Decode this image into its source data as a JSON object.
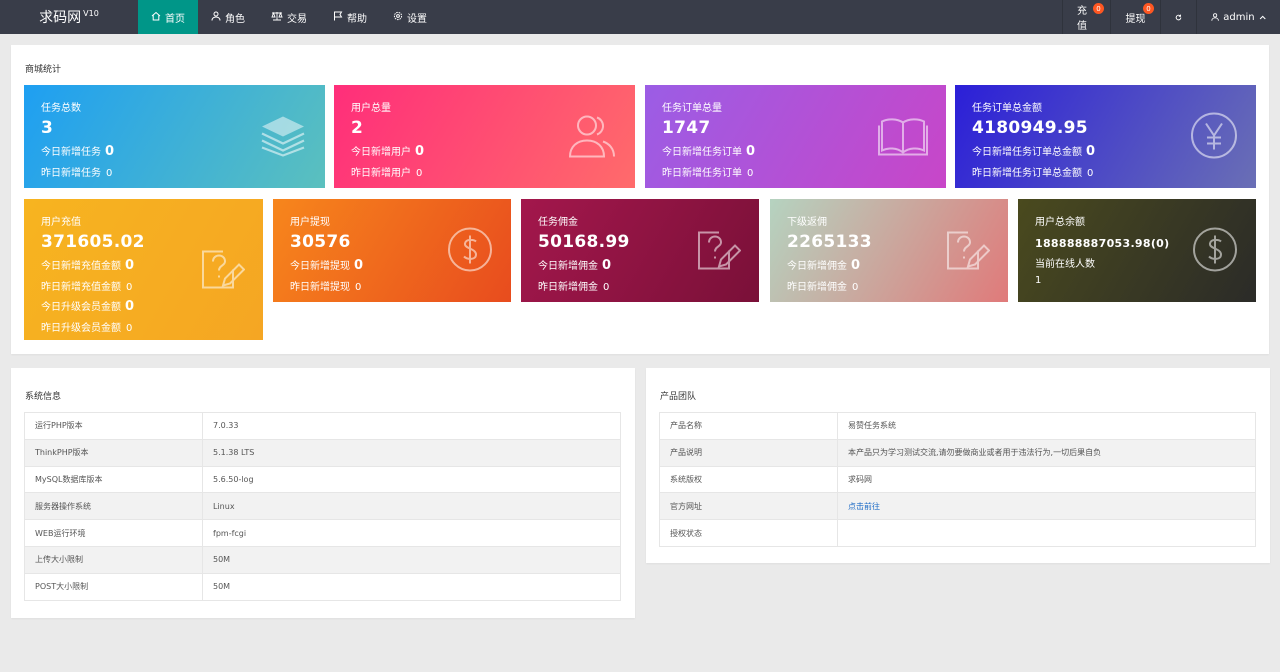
{
  "brand": {
    "name": "求码网",
    "version": "V10"
  },
  "nav": [
    {
      "label": "首页",
      "icon": "home-icon"
    },
    {
      "label": "角色",
      "icon": "user-icon"
    },
    {
      "label": "交易",
      "icon": "scale-icon"
    },
    {
      "label": "帮助",
      "icon": "flag-icon"
    },
    {
      "label": "设置",
      "icon": "gear-icon"
    }
  ],
  "right_nav": {
    "recharge": {
      "label": "充值",
      "badge": "0"
    },
    "withdraw": {
      "label": "提现",
      "badge": "0"
    },
    "refresh_icon": "refresh-icon",
    "user": "admin"
  },
  "stats": {
    "title": "商城统计",
    "cards": [
      {
        "title": "任务总数",
        "value": "3",
        "lines": [
          {
            "label": "今日新增任务",
            "val": "0",
            "bold": true
          },
          {
            "label": "昨日新增任务",
            "val": "0",
            "bold": false
          }
        ],
        "icon": "layers-icon",
        "gradient": [
          "#1e9ff2",
          "#5bc0be"
        ]
      },
      {
        "title": "用户总量",
        "value": "2",
        "lines": [
          {
            "label": "今日新增用户",
            "val": "0",
            "bold": true
          },
          {
            "label": "昨日新增用户",
            "val": "0",
            "bold": false
          }
        ],
        "icon": "users-icon",
        "gradient": [
          "#ff2e7a",
          "#ff6b6b"
        ]
      },
      {
        "title": "任务订单总量",
        "value": "1747",
        "lines": [
          {
            "label": "今日新增任务订单",
            "val": "0",
            "bold": true
          },
          {
            "label": "昨日新增任务订单",
            "val": "0",
            "bold": false
          }
        ],
        "icon": "book-icon",
        "gradient": [
          "#9b5de5",
          "#c846c8"
        ]
      },
      {
        "title": "任务订单总金额",
        "value": "4180949.95",
        "lines": [
          {
            "label": "今日新增任务订单总金额",
            "val": "0",
            "bold": true
          },
          {
            "label": "昨日新增任务订单总金额",
            "val": "0",
            "bold": false
          }
        ],
        "icon": "yen-icon",
        "gradient": [
          "#2b1fd8",
          "#6a6fb5"
        ]
      },
      {
        "title": "用户充值",
        "value": "371605.02",
        "lines": [
          {
            "label": "今日新增充值金额",
            "val": "0",
            "bold": true
          },
          {
            "label": "昨日新增充值金额",
            "val": "0",
            "bold": false
          },
          {
            "label": "今日升级会员金额",
            "val": "0",
            "bold": true
          },
          {
            "label": "昨日升级会员金额",
            "val": "0",
            "bold": false
          }
        ],
        "icon": "edit-icon",
        "gradient": [
          "#f7b420",
          "#f5a623"
        ]
      },
      {
        "title": "用户提现",
        "value": "30576",
        "lines": [
          {
            "label": "今日新增提现",
            "val": "0",
            "bold": true
          },
          {
            "label": "昨日新增提现",
            "val": "0",
            "bold": false
          }
        ],
        "icon": "dollar-icon",
        "gradient": [
          "#f7861c",
          "#e84c1e"
        ]
      },
      {
        "title": "任务佣金",
        "value": "50168.99",
        "lines": [
          {
            "label": "今日新增佣金",
            "val": "0",
            "bold": true
          },
          {
            "label": "昨日新增佣金",
            "val": "0",
            "bold": false
          }
        ],
        "icon": "edit-icon",
        "gradient": [
          "#a3174c",
          "#7a1038"
        ]
      },
      {
        "title": "下级返佣",
        "value": "2265133",
        "lines": [
          {
            "label": "今日新增佣金",
            "val": "0",
            "bold": true
          },
          {
            "label": "昨日新增佣金",
            "val": "0",
            "bold": false
          }
        ],
        "icon": "edit-icon",
        "gradient": [
          "#b5d3c0",
          "#e07a7a"
        ]
      },
      {
        "title": "用户总余额",
        "value": "188888887053.98(0)",
        "lines": [
          {
            "label": "当前在线人数",
            "val": "",
            "bold": true
          },
          {
            "label": "1",
            "val": "",
            "bold": false
          }
        ],
        "icon": "dollar-icon",
        "gradient": [
          "#4a4a1e",
          "#2b2b28"
        ]
      }
    ]
  },
  "system": {
    "title": "系统信息",
    "rows": [
      {
        "k": "运行PHP版本",
        "v": "7.0.33"
      },
      {
        "k": "ThinkPHP版本",
        "v": "5.1.38 LTS"
      },
      {
        "k": "MySQL数据库版本",
        "v": "5.6.50-log"
      },
      {
        "k": "服务器操作系统",
        "v": "Linux"
      },
      {
        "k": "WEB运行环境",
        "v": "fpm-fcgi"
      },
      {
        "k": "上传大小限制",
        "v": "50M"
      },
      {
        "k": "POST大小限制",
        "v": "50M"
      }
    ]
  },
  "product": {
    "title": "产品团队",
    "rows": [
      {
        "k": "产品名称",
        "v": "易赞任务系统"
      },
      {
        "k": "产品说明",
        "v": "本产品只为学习测试交流,请勿要做商业或者用于违法行为,一切后果自负"
      },
      {
        "k": "系统版权",
        "v": "求码网"
      },
      {
        "k": "官方网址",
        "v": "点击前往",
        "link": true
      },
      {
        "k": "授权状态",
        "v": ""
      }
    ]
  }
}
